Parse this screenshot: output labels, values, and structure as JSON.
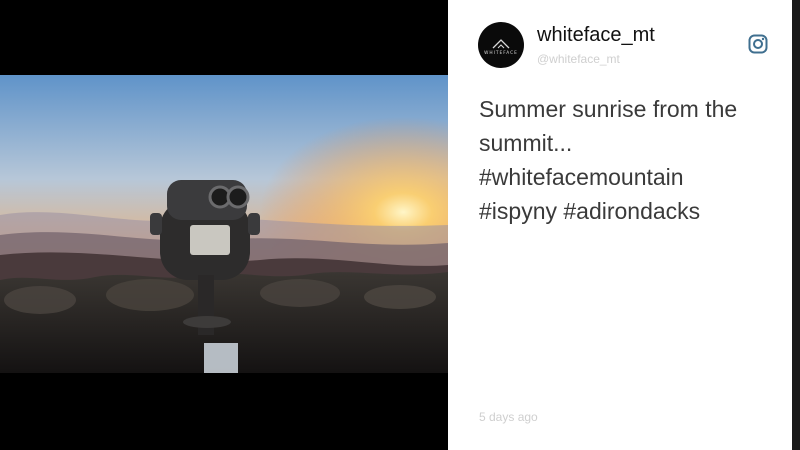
{
  "post": {
    "username": "whiteface_mt",
    "handle": "@whiteface_mt",
    "avatar_text": "WHITEFACE",
    "caption_lines": [
      "Summer sunrise from the",
      "summit...",
      "#whitefacemountain",
      "#ispyny #adirondacks"
    ],
    "timestamp": "5 days ago",
    "platform_icon": "instagram-icon",
    "photo_subject": "coin-operated binoculars on summit at sunrise"
  }
}
